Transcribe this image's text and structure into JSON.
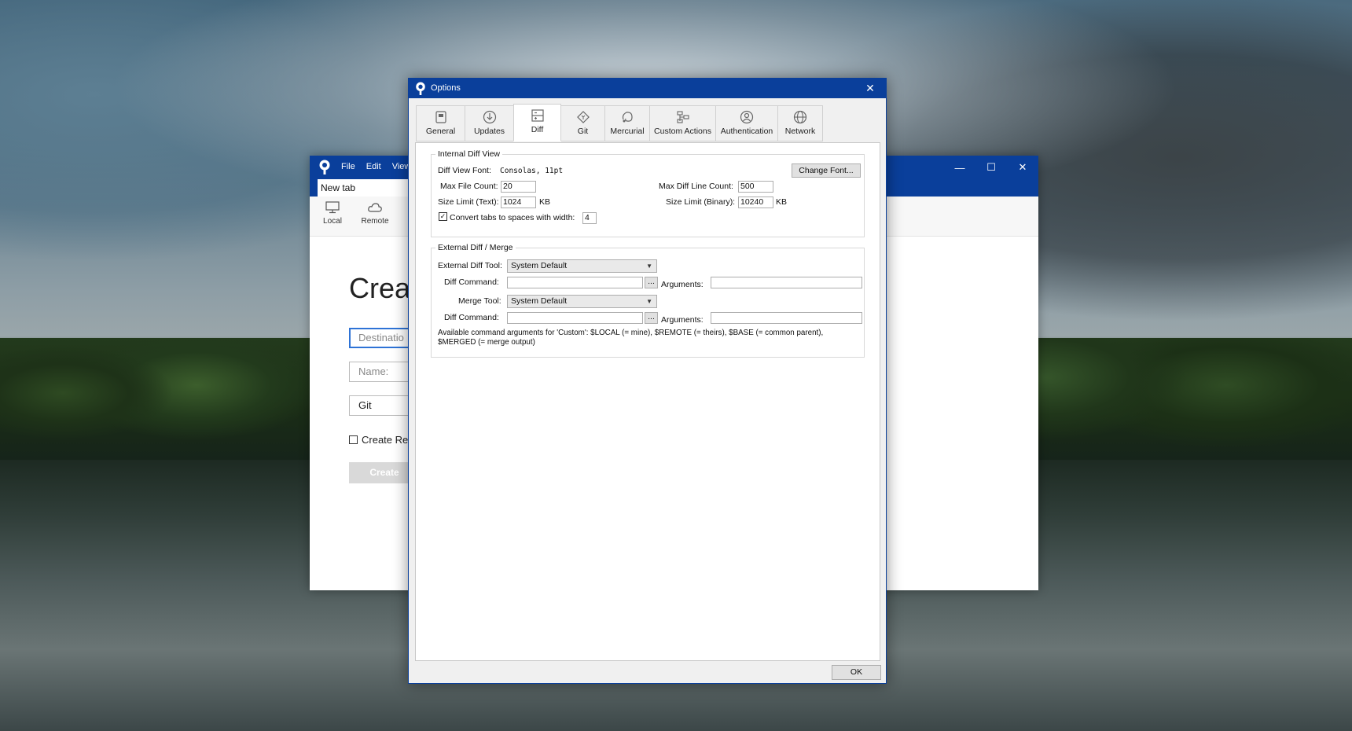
{
  "background_app": {
    "menu": [
      "File",
      "Edit",
      "View"
    ],
    "tab_label": "New tab",
    "ribbon": {
      "local": "Local",
      "remote": "Remote"
    },
    "heading": "Crea",
    "destination_placeholder": "Destinatio",
    "name_placeholder": "Name:",
    "repo_type": "Git",
    "create_checkbox": "Create Re",
    "create_button": "Create",
    "window_controls": {
      "minimize": "—",
      "maximize": "☐",
      "close": "✕"
    }
  },
  "dialog": {
    "title": "Options",
    "close": "✕",
    "tabs": [
      "General",
      "Updates",
      "Diff",
      "Git",
      "Mercurial",
      "Custom Actions",
      "Authentication",
      "Network"
    ],
    "active_tab": "Diff",
    "internal": {
      "group_label": "Internal Diff View",
      "font_label": "Diff View Font:",
      "font_value": "Consolas, 11pt",
      "change_font": "Change Font...",
      "max_file_count_label": "Max File Count:",
      "max_file_count": "20",
      "max_diff_line_label": "Max Diff Line Count:",
      "max_diff_line": "500",
      "size_text_label": "Size Limit (Text):",
      "size_text": "1024",
      "size_binary_label": "Size Limit (Binary):",
      "size_binary": "10240",
      "kb": "KB",
      "convert_tabs_label": "Convert tabs to spaces with width:",
      "convert_tabs_checked": "✓",
      "tab_width": "4"
    },
    "external": {
      "group_label": "External Diff / Merge",
      "ext_tool_label": "External Diff Tool:",
      "ext_tool_value": "System Default",
      "diff_command_label": "Diff Command:",
      "browse": "...",
      "arguments_label": "Arguments:",
      "merge_tool_label": "Merge Tool:",
      "merge_tool_value": "System Default",
      "merge_diff_command_label": "Diff Command:",
      "help_line1": "Available command arguments for 'Custom': $LOCAL (= mine), $REMOTE (= theirs), $BASE (= common parent),",
      "help_line2": "$MERGED (= merge output)"
    },
    "ok": "OK"
  }
}
